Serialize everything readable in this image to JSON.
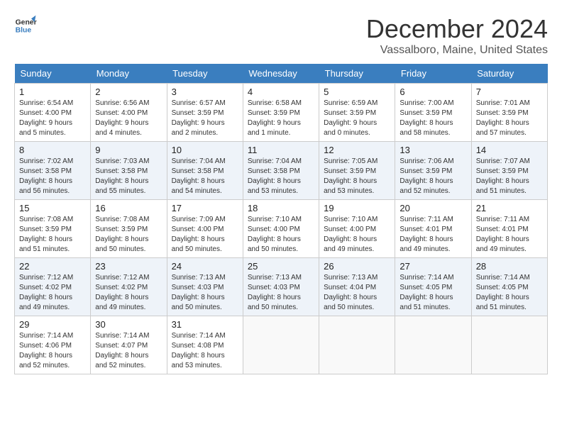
{
  "header": {
    "logo_line1": "General",
    "logo_line2": "Blue",
    "month_title": "December 2024",
    "location": "Vassalboro, Maine, United States"
  },
  "days_of_week": [
    "Sunday",
    "Monday",
    "Tuesday",
    "Wednesday",
    "Thursday",
    "Friday",
    "Saturday"
  ],
  "weeks": [
    [
      {
        "day": 1,
        "info": "Sunrise: 6:54 AM\nSunset: 4:00 PM\nDaylight: 9 hours\nand 5 minutes."
      },
      {
        "day": 2,
        "info": "Sunrise: 6:56 AM\nSunset: 4:00 PM\nDaylight: 9 hours\nand 4 minutes."
      },
      {
        "day": 3,
        "info": "Sunrise: 6:57 AM\nSunset: 3:59 PM\nDaylight: 9 hours\nand 2 minutes."
      },
      {
        "day": 4,
        "info": "Sunrise: 6:58 AM\nSunset: 3:59 PM\nDaylight: 9 hours\nand 1 minute."
      },
      {
        "day": 5,
        "info": "Sunrise: 6:59 AM\nSunset: 3:59 PM\nDaylight: 9 hours\nand 0 minutes."
      },
      {
        "day": 6,
        "info": "Sunrise: 7:00 AM\nSunset: 3:59 PM\nDaylight: 8 hours\nand 58 minutes."
      },
      {
        "day": 7,
        "info": "Sunrise: 7:01 AM\nSunset: 3:59 PM\nDaylight: 8 hours\nand 57 minutes."
      }
    ],
    [
      {
        "day": 8,
        "info": "Sunrise: 7:02 AM\nSunset: 3:58 PM\nDaylight: 8 hours\nand 56 minutes."
      },
      {
        "day": 9,
        "info": "Sunrise: 7:03 AM\nSunset: 3:58 PM\nDaylight: 8 hours\nand 55 minutes."
      },
      {
        "day": 10,
        "info": "Sunrise: 7:04 AM\nSunset: 3:58 PM\nDaylight: 8 hours\nand 54 minutes."
      },
      {
        "day": 11,
        "info": "Sunrise: 7:04 AM\nSunset: 3:58 PM\nDaylight: 8 hours\nand 53 minutes."
      },
      {
        "day": 12,
        "info": "Sunrise: 7:05 AM\nSunset: 3:59 PM\nDaylight: 8 hours\nand 53 minutes."
      },
      {
        "day": 13,
        "info": "Sunrise: 7:06 AM\nSunset: 3:59 PM\nDaylight: 8 hours\nand 52 minutes."
      },
      {
        "day": 14,
        "info": "Sunrise: 7:07 AM\nSunset: 3:59 PM\nDaylight: 8 hours\nand 51 minutes."
      }
    ],
    [
      {
        "day": 15,
        "info": "Sunrise: 7:08 AM\nSunset: 3:59 PM\nDaylight: 8 hours\nand 51 minutes."
      },
      {
        "day": 16,
        "info": "Sunrise: 7:08 AM\nSunset: 3:59 PM\nDaylight: 8 hours\nand 50 minutes."
      },
      {
        "day": 17,
        "info": "Sunrise: 7:09 AM\nSunset: 4:00 PM\nDaylight: 8 hours\nand 50 minutes."
      },
      {
        "day": 18,
        "info": "Sunrise: 7:10 AM\nSunset: 4:00 PM\nDaylight: 8 hours\nand 50 minutes."
      },
      {
        "day": 19,
        "info": "Sunrise: 7:10 AM\nSunset: 4:00 PM\nDaylight: 8 hours\nand 49 minutes."
      },
      {
        "day": 20,
        "info": "Sunrise: 7:11 AM\nSunset: 4:01 PM\nDaylight: 8 hours\nand 49 minutes."
      },
      {
        "day": 21,
        "info": "Sunrise: 7:11 AM\nSunset: 4:01 PM\nDaylight: 8 hours\nand 49 minutes."
      }
    ],
    [
      {
        "day": 22,
        "info": "Sunrise: 7:12 AM\nSunset: 4:02 PM\nDaylight: 8 hours\nand 49 minutes."
      },
      {
        "day": 23,
        "info": "Sunrise: 7:12 AM\nSunset: 4:02 PM\nDaylight: 8 hours\nand 49 minutes."
      },
      {
        "day": 24,
        "info": "Sunrise: 7:13 AM\nSunset: 4:03 PM\nDaylight: 8 hours\nand 50 minutes."
      },
      {
        "day": 25,
        "info": "Sunrise: 7:13 AM\nSunset: 4:03 PM\nDaylight: 8 hours\nand 50 minutes."
      },
      {
        "day": 26,
        "info": "Sunrise: 7:13 AM\nSunset: 4:04 PM\nDaylight: 8 hours\nand 50 minutes."
      },
      {
        "day": 27,
        "info": "Sunrise: 7:14 AM\nSunset: 4:05 PM\nDaylight: 8 hours\nand 51 minutes."
      },
      {
        "day": 28,
        "info": "Sunrise: 7:14 AM\nSunset: 4:05 PM\nDaylight: 8 hours\nand 51 minutes."
      }
    ],
    [
      {
        "day": 29,
        "info": "Sunrise: 7:14 AM\nSunset: 4:06 PM\nDaylight: 8 hours\nand 52 minutes."
      },
      {
        "day": 30,
        "info": "Sunrise: 7:14 AM\nSunset: 4:07 PM\nDaylight: 8 hours\nand 52 minutes."
      },
      {
        "day": 31,
        "info": "Sunrise: 7:14 AM\nSunset: 4:08 PM\nDaylight: 8 hours\nand 53 minutes."
      },
      null,
      null,
      null,
      null
    ]
  ]
}
